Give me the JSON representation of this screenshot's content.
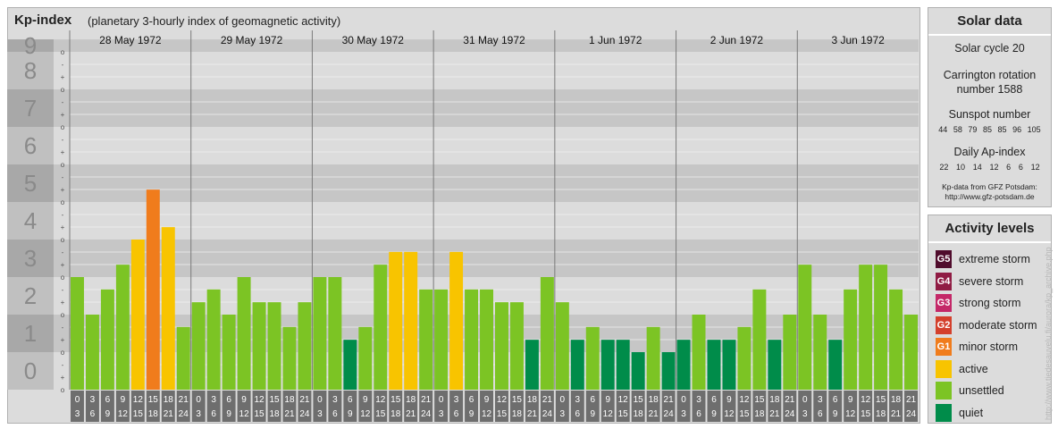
{
  "title": "Kp-index",
  "subtitle": "(planetary 3-hourly index of geomagnetic activity)",
  "chart_data": {
    "type": "bar",
    "days": [
      "28 May 1972",
      "29 May 1972",
      "30 May 1972",
      "31 May 1972",
      "1 Jun 1972",
      "2 Jun 1972",
      "3 Jun 1972"
    ],
    "interval_labels_top": [
      "0",
      "3",
      "6",
      "9",
      "12",
      "15",
      "18",
      "21"
    ],
    "interval_labels_bottom": [
      "3",
      "6",
      "9",
      "12",
      "15",
      "18",
      "21",
      "24"
    ],
    "y_tick_labels": [
      "0",
      "1",
      "2",
      "3",
      "4",
      "5",
      "6",
      "7",
      "8",
      "9"
    ],
    "minor_tick_labels": [
      "o",
      "+",
      "-"
    ],
    "ylim": [
      0,
      9.33
    ],
    "values": [
      3,
      2,
      2.67,
      3.33,
      4,
      5.33,
      4.33,
      1.67,
      2.33,
      2.67,
      2,
      3,
      2.33,
      2.33,
      1.67,
      2.33,
      3,
      3,
      1.33,
      1.67,
      3.33,
      3.67,
      3.67,
      2.67,
      2.67,
      3.67,
      2.67,
      2.67,
      2.33,
      2.33,
      1.33,
      3,
      2.33,
      1.33,
      1.67,
      1.33,
      1.33,
      1,
      1.67,
      1,
      1.33,
      2,
      1.33,
      1.33,
      1.67,
      2.67,
      1.33,
      2,
      3.33,
      2,
      1.33,
      2.67,
      3.33,
      3.33,
      2.67,
      2
    ]
  },
  "colors": {
    "quiet": "#008c4a",
    "unsettled": "#7cc424",
    "active": "#f8c400",
    "g1": "#f07c1c",
    "g2": "#d4402c",
    "g3": "#c42868",
    "g4": "#901c44",
    "g5": "#500c2c",
    "band_dark": "#c6c6c6",
    "band_light": "#dcdcdc",
    "tick_box": "#6e6e6e"
  },
  "solar": {
    "title": "Solar data",
    "cycle": "Solar cycle 20",
    "carrington_line1": "Carrington rotation",
    "carrington_line2": "number 1588",
    "sunspot_title": "Sunspot number",
    "sunspot_values": [
      "44",
      "58",
      "79",
      "85",
      "85",
      "96",
      "105"
    ],
    "ap_title": "Daily Ap-index",
    "ap_values": [
      "22",
      "10",
      "14",
      "12",
      "6",
      "6",
      "12"
    ],
    "credit_line1": "Kp-data from GFZ Potsdam:",
    "credit_line2": "http://www.gfz-potsdam.de"
  },
  "activity": {
    "title": "Activity levels",
    "levels": [
      {
        "code": "G5",
        "label": "extreme storm",
        "color": "#500c2c"
      },
      {
        "code": "G4",
        "label": "severe storm",
        "color": "#901c44"
      },
      {
        "code": "G3",
        "label": "strong storm",
        "color": "#c42868"
      },
      {
        "code": "G2",
        "label": "moderate storm",
        "color": "#d4402c"
      },
      {
        "code": "G1",
        "label": "minor storm",
        "color": "#f07c1c"
      },
      {
        "code": "",
        "label": "active",
        "color": "#f8c400"
      },
      {
        "code": "",
        "label": "unsettled",
        "color": "#7cc424"
      },
      {
        "code": "",
        "label": "quiet",
        "color": "#008c4a"
      }
    ]
  },
  "watermark": "http://www.tiedesauvelu.fi/aurora/kp_archive.php"
}
